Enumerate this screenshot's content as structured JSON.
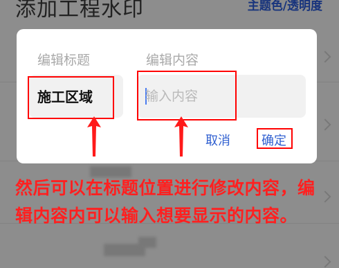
{
  "background": {
    "page_title": "添加工程水印",
    "theme_link": "主题色/透明度"
  },
  "dialog": {
    "title_field": {
      "label": "编辑标题",
      "value": "施工区域"
    },
    "content_field": {
      "label": "编辑内容",
      "placeholder": "输入内容",
      "value": ""
    },
    "cancel_label": "取消",
    "confirm_label": "确定"
  },
  "annotation": {
    "text": "然后可以在标题位置进行修改内容，编辑内容内可以输入想要显示的内容。"
  },
  "colors": {
    "annotation": "#ff2020",
    "highlight_box": "#ff0000",
    "button_text": "#2f5fd0",
    "theme_link": "#2a5bd7"
  }
}
